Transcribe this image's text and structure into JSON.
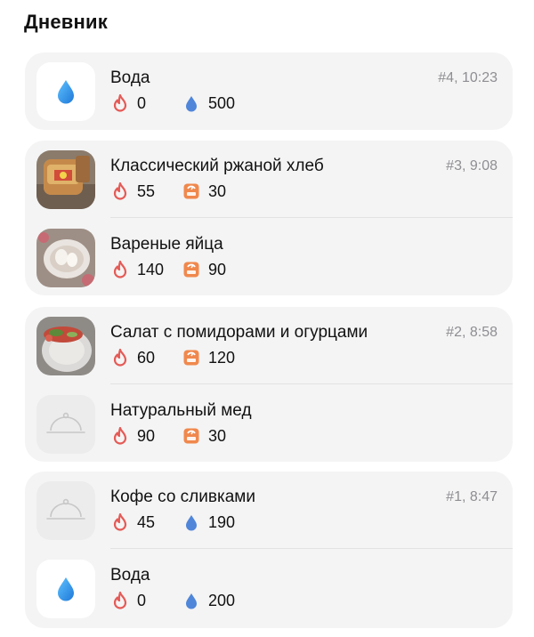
{
  "page": {
    "title": "Дневник"
  },
  "colors": {
    "flame": "#e55b57",
    "water": "#4f86d9",
    "scale": "#f0884d",
    "card": "#f4f4f4",
    "meta": "#8e8e93"
  },
  "groups": [
    {
      "meta": "#4, 10:23",
      "items": [
        {
          "name": "Вода",
          "thumb": "water-drop-icon",
          "calories": "0",
          "second_icon": "water-drop-icon",
          "second": "500"
        }
      ]
    },
    {
      "meta": "#3, 9:08",
      "items": [
        {
          "name": "Классический ржаной хлеб",
          "thumb": "bread-photo",
          "calories": "55",
          "second_icon": "scale-icon",
          "second": "30"
        },
        {
          "name": "Вареные яйца",
          "thumb": "eggs-photo",
          "calories": "140",
          "second_icon": "scale-icon",
          "second": "90"
        }
      ]
    },
    {
      "meta": "#2, 8:58",
      "items": [
        {
          "name": "Салат с помидорами и огурцами",
          "thumb": "salad-photo",
          "calories": "60",
          "second_icon": "scale-icon",
          "second": "120"
        },
        {
          "name": "Натуральный мед",
          "thumb": "cloche-icon",
          "calories": "90",
          "second_icon": "scale-icon",
          "second": "30"
        }
      ]
    },
    {
      "meta": "#1, 8:47",
      "items": [
        {
          "name": "Кофе со сливками",
          "thumb": "cloche-icon",
          "calories": "45",
          "second_icon": "water-drop-icon",
          "second": "190"
        },
        {
          "name": "Вода",
          "thumb": "water-drop-icon",
          "calories": "0",
          "second_icon": "water-drop-icon",
          "second": "200"
        }
      ]
    }
  ]
}
